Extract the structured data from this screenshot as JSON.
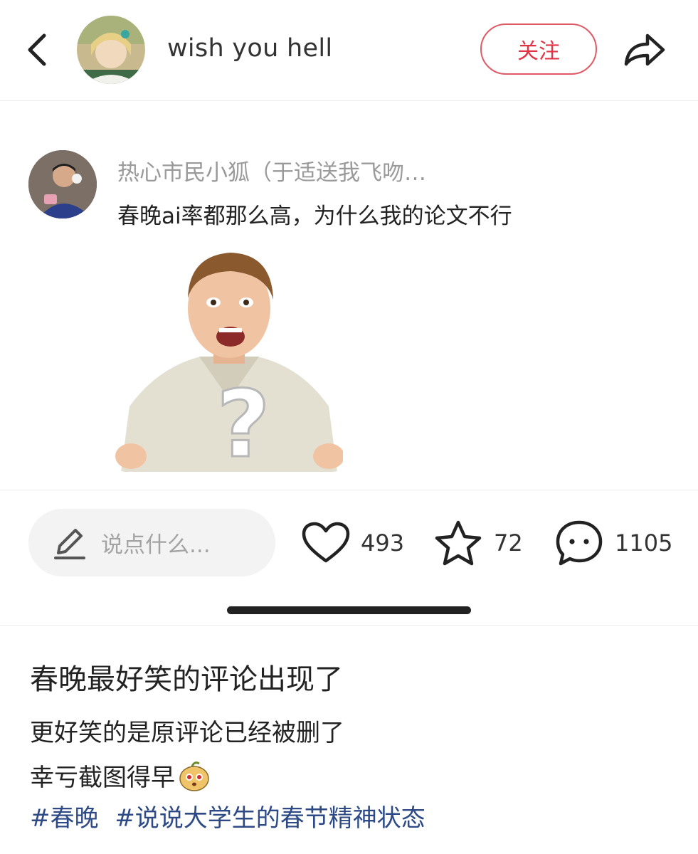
{
  "header": {
    "author_name": "wish you hell",
    "follow_label": "关注",
    "back_icon": "chevron-left-icon",
    "share_icon": "share-arrow-icon"
  },
  "comment_card": {
    "commenter_name": "热心市民小狐（于适送我飞吻…",
    "comment_text": "春晚ai率都那么高，为什么我的论文不行"
  },
  "action_bar": {
    "input_placeholder": "说点什么...",
    "likes": "493",
    "favorites": "72",
    "comments": "1105",
    "icons": [
      "pencil-icon",
      "heart-icon",
      "star-icon",
      "comment-bubble-icon"
    ]
  },
  "post": {
    "title": "春晚最好笑的评论出现了",
    "line1": "更好笑的是原评论已经被删了",
    "line2": "幸亏截图得早",
    "tags": [
      "#春晚",
      "#说说大学生的春节精神状态"
    ]
  },
  "colors": {
    "accent_red": "#e23345",
    "tag_blue": "#2d4a86",
    "muted_gray": "#9a9a9a"
  }
}
